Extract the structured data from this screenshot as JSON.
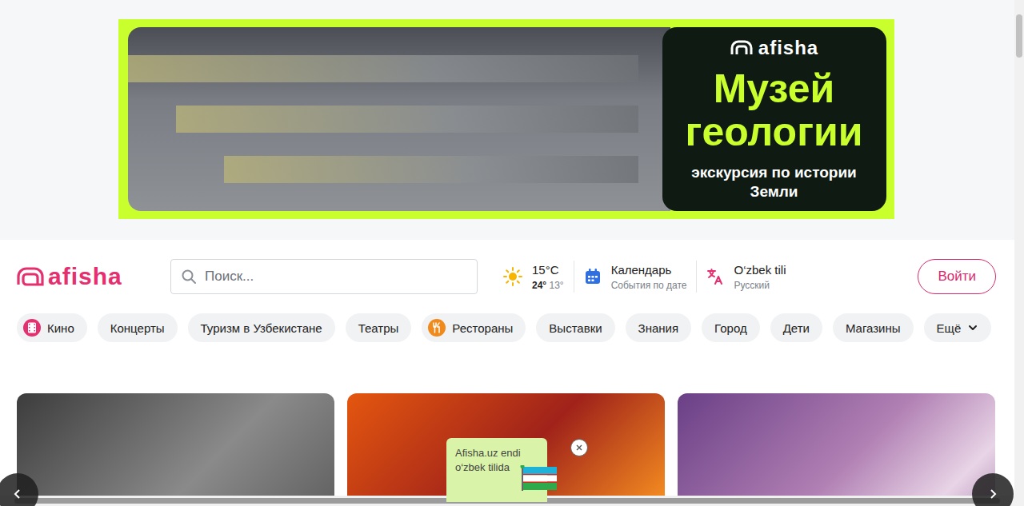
{
  "banner": {
    "logo": "afisha",
    "title_lines": [
      "Музей",
      "геологии"
    ],
    "subtitle": "экскурсия по истории Земли"
  },
  "header": {
    "logo": "afisha",
    "search": {
      "placeholder": "Поиск..."
    },
    "weather": {
      "temperature": "15°C",
      "high": "24°",
      "low": "13°"
    },
    "calendar": {
      "title": "Календарь",
      "subtitle": "События по дате"
    },
    "language": {
      "current": "O‘zbek tili",
      "alternate": "Русский"
    },
    "login": "Войти"
  },
  "categories": [
    {
      "label": "Кино",
      "kind": "film"
    },
    {
      "label": "Концерты",
      "kind": "plain"
    },
    {
      "label": "Туризм в Узбекистане",
      "kind": "plain"
    },
    {
      "label": "Театры",
      "kind": "plain"
    },
    {
      "label": "Рестораны",
      "kind": "food"
    },
    {
      "label": "Выставки",
      "kind": "plain"
    },
    {
      "label": "Знания",
      "kind": "plain"
    },
    {
      "label": "Город",
      "kind": "plain"
    },
    {
      "label": "Дети",
      "kind": "plain"
    },
    {
      "label": "Магазины",
      "kind": "plain"
    },
    {
      "label": "Ещё",
      "kind": "dropdown"
    }
  ],
  "cards": [
    {
      "kind": "gray"
    },
    {
      "kind": "stage"
    },
    {
      "kind": "dance"
    }
  ],
  "tooltip": {
    "text": "Afisha.uz endi o‘zbek tilida"
  }
}
